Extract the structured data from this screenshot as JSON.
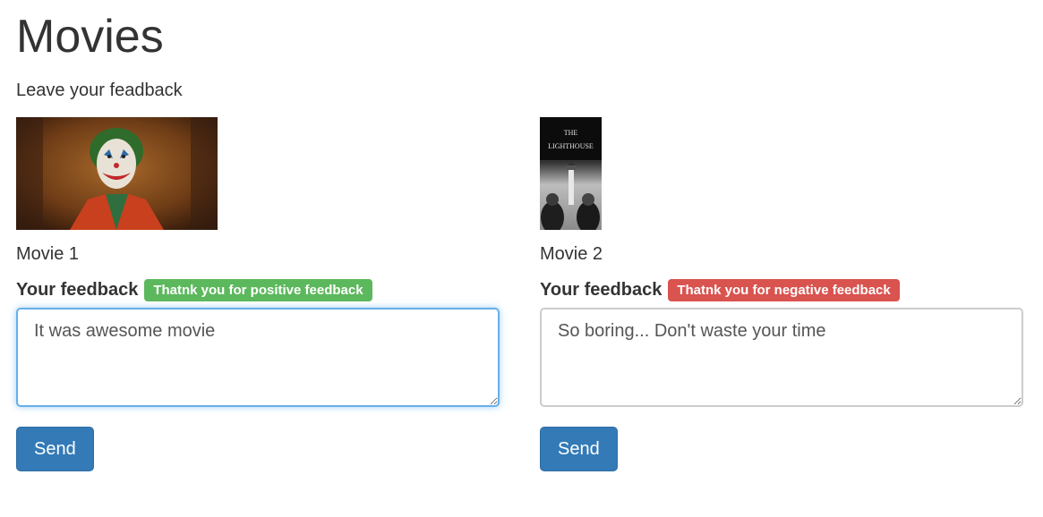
{
  "page": {
    "title": "Movies",
    "subtitle": "Leave your feadback"
  },
  "movies": [
    {
      "name": "Movie 1",
      "poster_alt": "Joker",
      "feedback_label": "Your feedback",
      "badge_text": "Thatnk you for positive feedback",
      "badge_type": "positive",
      "feedback_value": "It was awesome movie",
      "send_label": "Send"
    },
    {
      "name": "Movie 2",
      "poster_alt": "The Lighthouse",
      "poster_title_line1": "THE",
      "poster_title_line2": "LIGHTHOUSE",
      "feedback_label": "Your feedback",
      "badge_text": "Thatnk you for negative feedback",
      "badge_type": "negative",
      "feedback_value": "So boring... Don't waste your time",
      "send_label": "Send"
    }
  ],
  "colors": {
    "positive": "#5cb85c",
    "negative": "#d9534f",
    "primary": "#337ab7",
    "focus": "#66afe9"
  }
}
